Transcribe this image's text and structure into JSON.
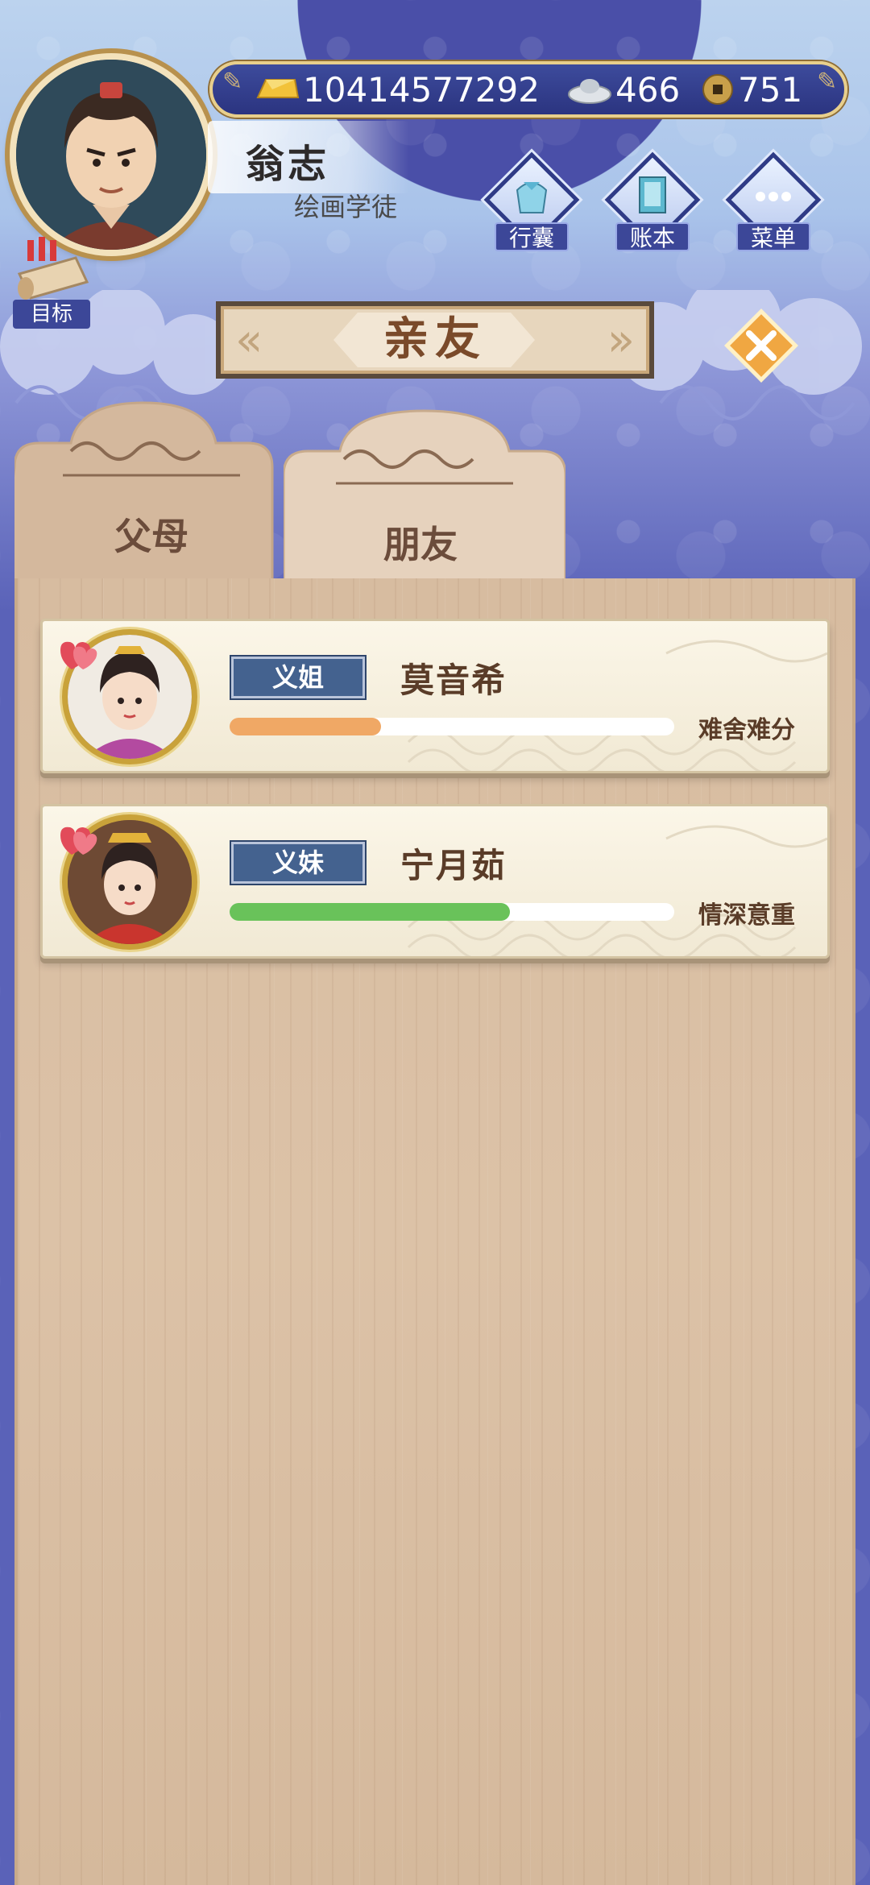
{
  "player": {
    "name": "翁志",
    "title": "绘画学徒"
  },
  "currency": {
    "gold": "10414577292",
    "silver": "466",
    "copper": "751"
  },
  "hud": {
    "bag_label": "行囊",
    "ledger_label": "账本",
    "menu_label": "菜单",
    "goal_label": "目标"
  },
  "page": {
    "title": "亲友"
  },
  "tabs": [
    {
      "label": "父母",
      "active": false
    },
    {
      "label": "朋友",
      "active": true
    }
  ],
  "friends": [
    {
      "relation": "义姐",
      "name": "莫音希",
      "bond": "难舍难分",
      "affection": 0.34,
      "bar_color": "#f0a865"
    },
    {
      "relation": "义妹",
      "name": "宁月茹",
      "bond": "情深意重",
      "affection": 0.63,
      "bar_color": "#69c25a"
    }
  ],
  "colors": {
    "accent_gold": "#e8cf8c",
    "tag_blue": "#44628f",
    "text_brown": "#5a3c28"
  }
}
